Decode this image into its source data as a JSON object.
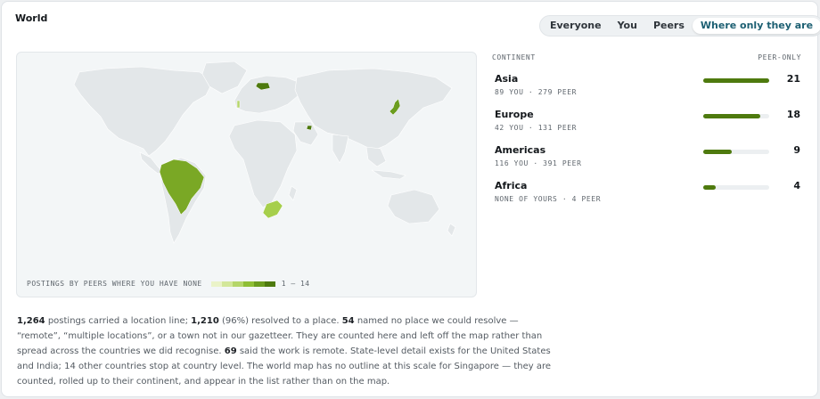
{
  "header": {
    "title": "World"
  },
  "filters": {
    "options": [
      "Everyone",
      "You",
      "Peers",
      "Where only they are"
    ],
    "selected": "Where only they are"
  },
  "map": {
    "legend_label": "POSTINGS BY PEERS WHERE YOU HAVE NONE",
    "legend_range": "1 — 14",
    "colors": {
      "land": "#e3e7e9",
      "ocean": "#f3f6f7",
      "scale": [
        "#eaf3c8",
        "#d3e79a",
        "#b5d66a",
        "#8fbf36",
        "#6c9d1f",
        "#4e7a0e"
      ]
    }
  },
  "table": {
    "col_continent": "CONTINENT",
    "col_value": "PEER-ONLY",
    "rows": [
      {
        "name": "Asia",
        "sub": "89 YOU · 279 PEER",
        "value": "21",
        "fraction": 1.0
      },
      {
        "name": "Europe",
        "sub": "42 YOU · 131 PEER",
        "value": "18",
        "fraction": 0.86
      },
      {
        "name": "Americas",
        "sub": "116 YOU · 391 PEER",
        "value": "9",
        "fraction": 0.43
      },
      {
        "name": "Africa",
        "sub": "NONE OF YOURS · 4 PEER",
        "value": "4",
        "fraction": 0.19
      }
    ]
  },
  "summary": {
    "n_total": "1,264",
    "t1": " postings carried a location line; ",
    "n_resolved": "1,210",
    "t2": " (96%) resolved to a place. ",
    "n_unresolved": "54",
    "t3": " named no place we could resolve — “remote”, “multiple locations”, or a town not in our gazetteer. They are counted here and left off the map rather than spread across the countries we did recognise. ",
    "n_remote": "69",
    "t4": " said the work is remote. State-level detail exists for the United States and India; 14 other countries stop at country level. The world map has no outline at this scale for Singapore — they are counted, rolled up to their continent, and appear in the list rather than on the map."
  }
}
